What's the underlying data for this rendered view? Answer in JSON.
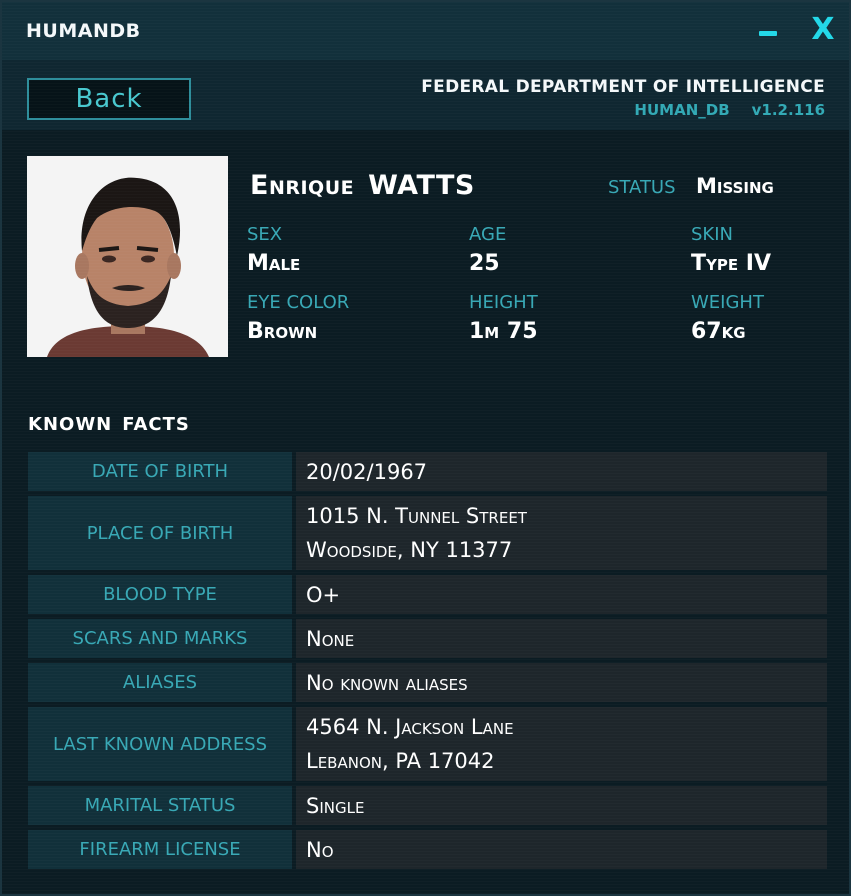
{
  "window": {
    "title": "HUMANDB",
    "minimize_icon": "minimize-icon",
    "close_icon": "close-icon",
    "close_glyph": "X"
  },
  "header": {
    "back_label": "Back",
    "agency": "FEDERAL DEPARTMENT OF INTELLIGENCE",
    "db_name": "HUMAN_DB",
    "version": "v1.2.116"
  },
  "profile": {
    "first_name": "Enrique",
    "last_name": "WATTS",
    "status_label": "STATUS",
    "status_value": "Missing",
    "attributes": [
      {
        "label": "SEX",
        "value": "Male"
      },
      {
        "label": "AGE",
        "value": "25"
      },
      {
        "label": "SKIN",
        "value": "Type IV"
      },
      {
        "label": "EYE COLOR",
        "value": "Brown"
      },
      {
        "label": "HEIGHT",
        "value": "1m 75"
      },
      {
        "label": "WEIGHT",
        "value": "67kg"
      }
    ]
  },
  "facts": {
    "title_words": [
      "KNOWN",
      "FACTS"
    ],
    "rows": [
      {
        "label": "DATE OF BIRTH",
        "lines": [
          "20/02/1967"
        ]
      },
      {
        "label": "PLACE OF BIRTH",
        "lines": [
          "1015 N. Tunnel Street",
          "Woodside, NY 11377"
        ]
      },
      {
        "label": "BLOOD TYPE",
        "lines": [
          "O+"
        ]
      },
      {
        "label": "SCARS AND MARKS",
        "lines": [
          "None"
        ]
      },
      {
        "label": "ALIASES",
        "lines": [
          "No known aliases"
        ]
      },
      {
        "label": "LAST KNOWN ADDRESS",
        "lines": [
          "4564 N. Jackson Lane",
          "Lebanon, PA 17042"
        ]
      },
      {
        "label": "MARITAL STATUS",
        "lines": [
          "Single"
        ]
      },
      {
        "label": "FIREARM LICENSE",
        "lines": [
          "No"
        ]
      }
    ]
  },
  "colors": {
    "accent": "#22d8e8",
    "label": "#38a8b5",
    "panel": "#11303a",
    "value_bg": "#1e262b"
  }
}
